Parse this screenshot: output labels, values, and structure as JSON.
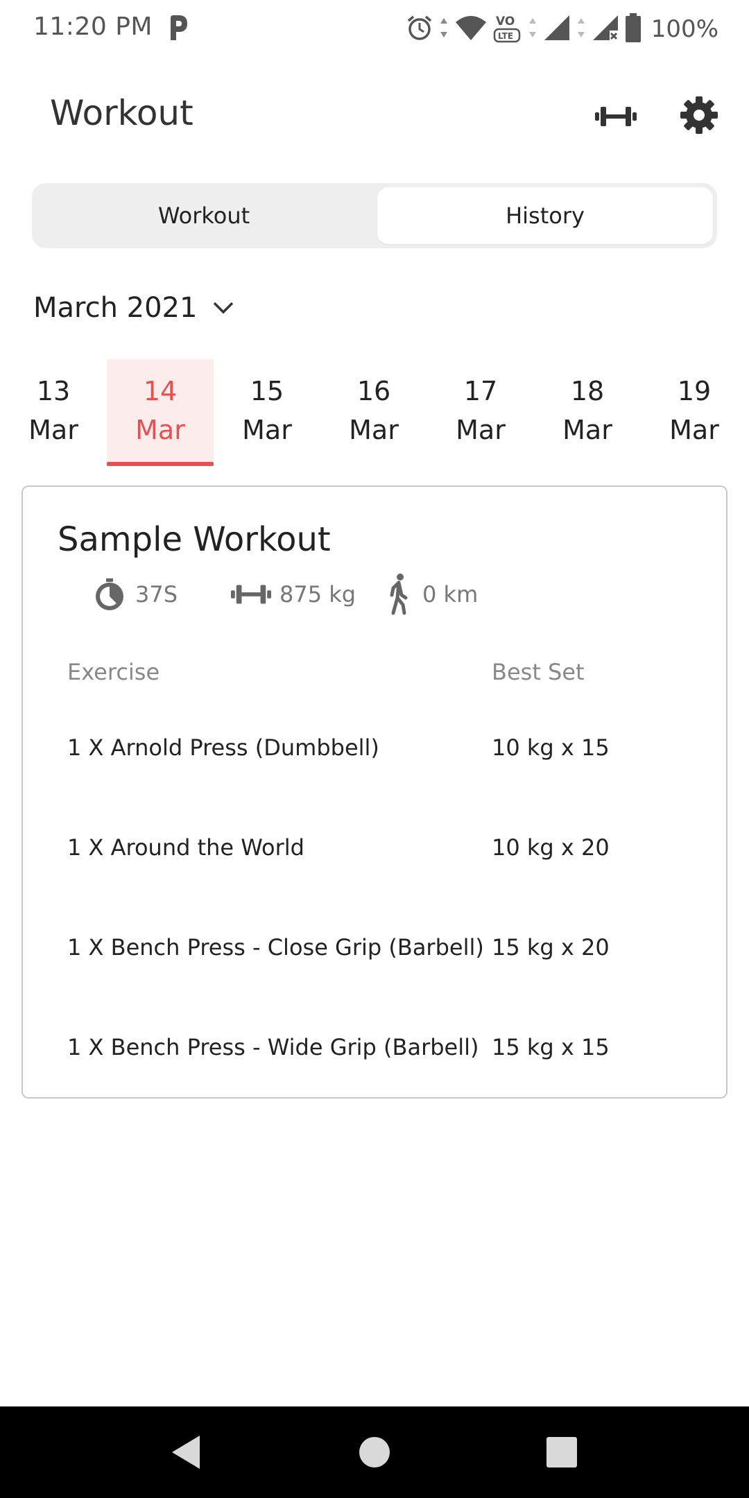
{
  "status_bar": {
    "time": "11:20 PM",
    "battery_percent": "100%",
    "icons": [
      "p-app-icon",
      "alarm-icon",
      "wifi-icon",
      "volte-icon",
      "signal-icon",
      "signal-no-data-icon",
      "battery-icon"
    ]
  },
  "app_bar": {
    "title": "Workout",
    "actions": [
      "dumbbell-icon",
      "settings-gear-icon"
    ]
  },
  "tabs": [
    {
      "label": "Workout",
      "selected": false
    },
    {
      "label": "History",
      "selected": true
    }
  ],
  "month_selector": {
    "label": "March 2021",
    "icon": "chevron-down-icon"
  },
  "dates": [
    {
      "day": "13",
      "month": "Mar",
      "selected": false
    },
    {
      "day": "14",
      "month": "Mar",
      "selected": true
    },
    {
      "day": "15",
      "month": "Mar",
      "selected": false
    },
    {
      "day": "16",
      "month": "Mar",
      "selected": false
    },
    {
      "day": "17",
      "month": "Mar",
      "selected": false
    },
    {
      "day": "18",
      "month": "Mar",
      "selected": false
    },
    {
      "day": "19",
      "month": "Mar",
      "selected": false
    }
  ],
  "workout": {
    "title": "Sample Workout",
    "stats": {
      "duration": "37S",
      "volume": "875 kg",
      "distance": "0 km"
    },
    "columns": {
      "exercise": "Exercise",
      "best_set": "Best Set"
    },
    "exercises": [
      {
        "name": "1 X Arnold Press (Dumbbell)",
        "best_set": "10 kg x 15"
      },
      {
        "name": "1 X Around the World",
        "best_set": "10 kg x 20"
      },
      {
        "name": "1 X Bench Press - Close Grip (Barbell)",
        "best_set": "15 kg x 20"
      },
      {
        "name": "1 X Bench Press - Wide Grip (Barbell)",
        "best_set": "15 kg x 15"
      }
    ]
  },
  "colors": {
    "accent": "#e8504f",
    "accent_bg": "#fdecec",
    "tab_bg": "#eeeeee",
    "icon_gray": "#666666"
  },
  "nav_bar": {
    "buttons": [
      "back-icon",
      "home-icon",
      "recents-icon"
    ]
  }
}
